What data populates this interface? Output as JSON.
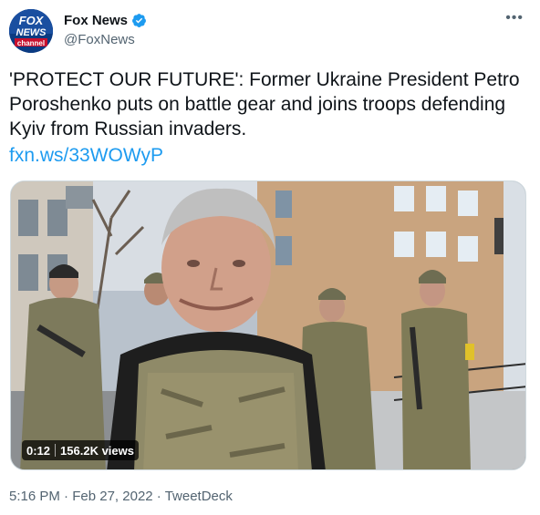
{
  "account": {
    "display_name": "Fox News",
    "handle": "@FoxNews",
    "verified": true,
    "avatar_icon": "fox-news-channel-logo-icon",
    "avatar_text_top": "FOX",
    "avatar_text_mid": "NEWS",
    "avatar_text_bottom": "channel"
  },
  "menu": {
    "more_label": "•••"
  },
  "tweet": {
    "text": "'PROTECT OUR FUTURE': Former Ukraine President Petro Poroshenko puts on battle gear and joins troops defending Kyiv from Russian invaders.",
    "link": "fxn.ws/33WOWyP"
  },
  "media": {
    "duration": "0:12",
    "views": "156.2K views"
  },
  "meta": {
    "time": "5:16 PM",
    "separator": " · ",
    "date": "Feb 27, 2022",
    "source": "TweetDeck"
  },
  "colors": {
    "link": "#1d9bf0",
    "secondary_text": "#536471",
    "verified_badge": "#1d9bf0"
  }
}
